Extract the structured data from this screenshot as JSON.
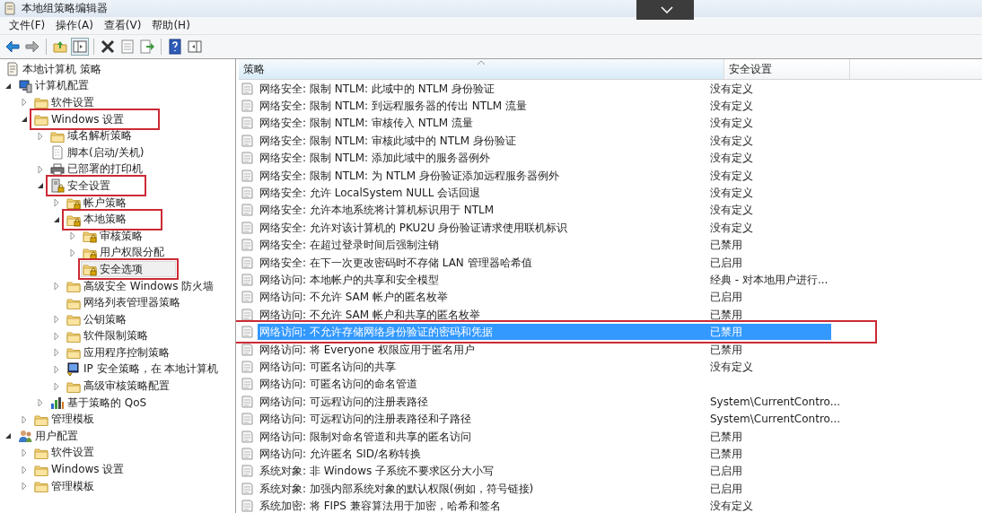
{
  "window": {
    "title": "本地组策略编辑器"
  },
  "menu": [
    "文件(F)",
    "操作(A)",
    "查看(V)",
    "帮助(H)"
  ],
  "tree": [
    {
      "label": "本地计算机 策略",
      "kind": "document",
      "selected": false,
      "highlighted": false,
      "children": [
        {
          "label": "计算机配置",
          "kind": "computer",
          "expanded": true,
          "selected": false,
          "highlighted": false,
          "children": [
            {
              "label": "软件设置",
              "kind": "folder",
              "expanded": false,
              "selected": false,
              "highlighted": false
            },
            {
              "label": "Windows 设置",
              "kind": "folder",
              "expanded": true,
              "selected": false,
              "highlighted": true,
              "children": [
                {
                  "label": "域名解析策略",
                  "kind": "folder",
                  "expanded": false,
                  "selected": false,
                  "highlighted": false
                },
                {
                  "label": "脚本(启动/关机)",
                  "kind": "script",
                  "selected": false,
                  "highlighted": false
                },
                {
                  "label": "已部署的打印机",
                  "kind": "printer",
                  "expanded": false,
                  "selected": false,
                  "highlighted": false
                },
                {
                  "label": "安全设置",
                  "kind": "secure",
                  "expanded": true,
                  "selected": false,
                  "highlighted": true,
                  "children": [
                    {
                      "label": "帐户策略",
                      "kind": "lockfolder",
                      "expanded": false,
                      "selected": false,
                      "highlighted": false
                    },
                    {
                      "label": "本地策略",
                      "kind": "lockfolder",
                      "expanded": true,
                      "selected": false,
                      "highlighted": true,
                      "children": [
                        {
                          "label": "审核策略",
                          "kind": "lockfolder",
                          "expanded": false,
                          "selected": false,
                          "highlighted": false
                        },
                        {
                          "label": "用户权限分配",
                          "kind": "lockfolder",
                          "expanded": false,
                          "selected": false,
                          "highlighted": false
                        },
                        {
                          "label": "安全选项",
                          "kind": "lockfolder",
                          "selected": true,
                          "highlighted": true
                        }
                      ]
                    },
                    {
                      "label": "高级安全 Windows 防火墙",
                      "kind": "folder",
                      "expanded": false,
                      "selected": false,
                      "highlighted": false
                    },
                    {
                      "label": "网络列表管理器策略",
                      "kind": "folder",
                      "selected": false,
                      "highlighted": false
                    },
                    {
                      "label": "公钥策略",
                      "kind": "folder",
                      "expanded": false,
                      "selected": false,
                      "highlighted": false
                    },
                    {
                      "label": "软件限制策略",
                      "kind": "folder",
                      "expanded": false,
                      "selected": false,
                      "highlighted": false
                    },
                    {
                      "label": "应用程序控制策略",
                      "kind": "folder",
                      "expanded": false,
                      "selected": false,
                      "highlighted": false
                    },
                    {
                      "label": "IP 安全策略，在 本地计算机",
                      "kind": "ipsec",
                      "expanded": false,
                      "selected": false,
                      "highlighted": false
                    },
                    {
                      "label": "高级审核策略配置",
                      "kind": "folder",
                      "expanded": false,
                      "selected": false,
                      "highlighted": false
                    }
                  ]
                },
                {
                  "label": "基于策略的 QoS",
                  "kind": "chart",
                  "expanded": false,
                  "selected": false,
                  "highlighted": false
                }
              ]
            },
            {
              "label": "管理模板",
              "kind": "folder",
              "expanded": false,
              "selected": false,
              "highlighted": false
            }
          ]
        },
        {
          "label": "用户配置",
          "kind": "user",
          "expanded": true,
          "selected": false,
          "highlighted": false,
          "children": [
            {
              "label": "软件设置",
              "kind": "folder",
              "expanded": false,
              "selected": false,
              "highlighted": false
            },
            {
              "label": "Windows 设置",
              "kind": "folder",
              "expanded": false,
              "selected": false,
              "highlighted": false
            },
            {
              "label": "管理模板",
              "kind": "folder",
              "expanded": false,
              "selected": false,
              "highlighted": false
            }
          ]
        }
      ]
    }
  ],
  "table": {
    "columns": [
      "策略",
      "安全设置"
    ],
    "rows": [
      {
        "policy": "网络安全: 限制 NTLM: 此域中的 NTLM 身份验证",
        "setting": "没有定义",
        "selected": false,
        "highlighted": false
      },
      {
        "policy": "网络安全: 限制 NTLM: 到远程服务器的传出 NTLM 流量",
        "setting": "没有定义",
        "selected": false,
        "highlighted": false
      },
      {
        "policy": "网络安全: 限制 NTLM: 审核传入 NTLM 流量",
        "setting": "没有定义",
        "selected": false,
        "highlighted": false
      },
      {
        "policy": "网络安全: 限制 NTLM: 审核此域中的 NTLM 身份验证",
        "setting": "没有定义",
        "selected": false,
        "highlighted": false
      },
      {
        "policy": "网络安全: 限制 NTLM: 添加此域中的服务器例外",
        "setting": "没有定义",
        "selected": false,
        "highlighted": false
      },
      {
        "policy": "网络安全: 限制 NTLM: 为 NTLM 身份验证添加远程服务器例外",
        "setting": "没有定义",
        "selected": false,
        "highlighted": false
      },
      {
        "policy": "网络安全: 允许 LocalSystem NULL 会话回退",
        "setting": "没有定义",
        "selected": false,
        "highlighted": false
      },
      {
        "policy": "网络安全: 允许本地系统将计算机标识用于 NTLM",
        "setting": "没有定义",
        "selected": false,
        "highlighted": false
      },
      {
        "policy": "网络安全: 允许对该计算机的 PKU2U 身份验证请求使用联机标识",
        "setting": "没有定义",
        "selected": false,
        "highlighted": false
      },
      {
        "policy": "网络安全: 在超过登录时间后强制注销",
        "setting": "已禁用",
        "selected": false,
        "highlighted": false
      },
      {
        "policy": "网络安全: 在下一次更改密码时不存储 LAN 管理器哈希值",
        "setting": "已启用",
        "selected": false,
        "highlighted": false
      },
      {
        "policy": "网络访问: 本地帐户的共享和安全模型",
        "setting": "经典 - 对本地用户进行...",
        "selected": false,
        "highlighted": false
      },
      {
        "policy": "网络访问: 不允许 SAM 帐户的匿名枚举",
        "setting": "已启用",
        "selected": false,
        "highlighted": false
      },
      {
        "policy": "网络访问: 不允许 SAM 帐户和共享的匿名枚举",
        "setting": "已禁用",
        "selected": false,
        "highlighted": false
      },
      {
        "policy": "网络访问: 不允许存储网络身份验证的密码和凭据",
        "setting": "已禁用",
        "selected": true,
        "highlighted": true
      },
      {
        "policy": "网络访问: 将 Everyone 权限应用于匿名用户",
        "setting": "已禁用",
        "selected": false,
        "highlighted": false
      },
      {
        "policy": "网络访问: 可匿名访问的共享",
        "setting": "没有定义",
        "selected": false,
        "highlighted": false
      },
      {
        "policy": "网络访问: 可匿名访问的命名管道",
        "selected": false,
        "highlighted": false
      },
      {
        "policy": "网络访问: 可远程访问的注册表路径",
        "setting": "System\\CurrentContro...",
        "selected": false,
        "highlighted": false
      },
      {
        "policy": "网络访问: 可远程访问的注册表路径和子路径",
        "setting": "System\\CurrentContro...",
        "selected": false,
        "highlighted": false
      },
      {
        "policy": "网络访问: 限制对命名管道和共享的匿名访问",
        "setting": "已禁用",
        "selected": false,
        "highlighted": false
      },
      {
        "policy": "网络访问: 允许匿名 SID/名称转换",
        "setting": "已禁用",
        "selected": false,
        "highlighted": false
      },
      {
        "policy": "系统对象: 非 Windows 子系统不要求区分大小写",
        "setting": "已启用",
        "selected": false,
        "highlighted": false
      },
      {
        "policy": "系统对象: 加强内部系统对象的默认权限(例如，符号链接)",
        "setting": "已启用",
        "selected": false,
        "highlighted": false
      },
      {
        "policy": "系统加密: 将 FIPS 兼容算法用于加密，哈希和签名",
        "setting": "没有定义",
        "selected": false,
        "highlighted": false
      }
    ]
  }
}
